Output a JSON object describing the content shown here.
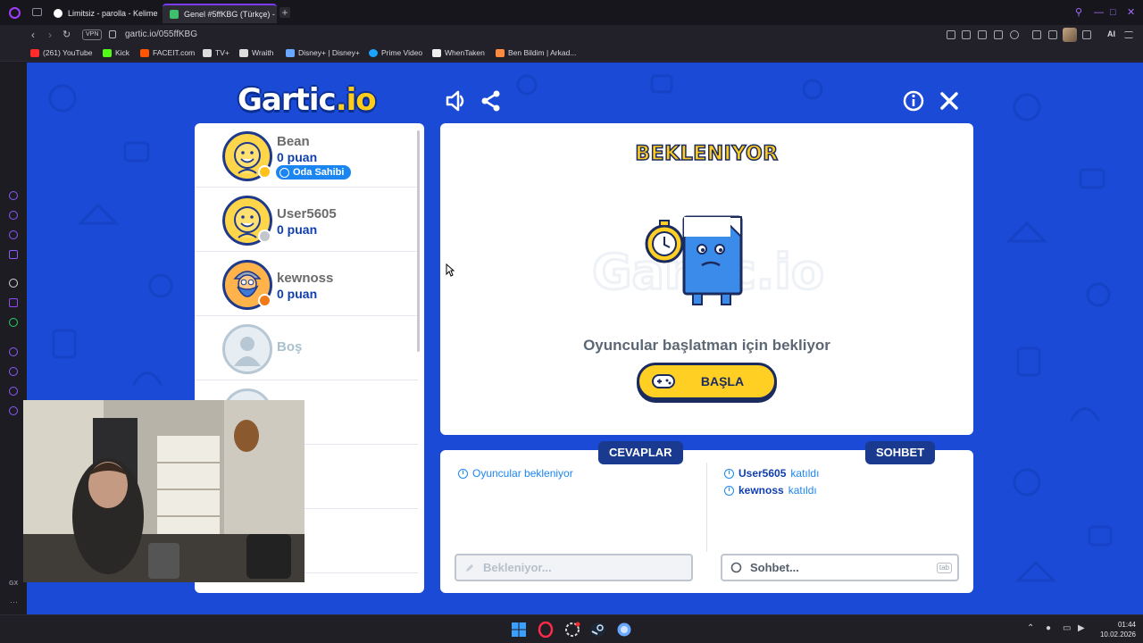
{
  "browser": {
    "tabs": [
      {
        "title": "Limitsiz - parolla - Kelime",
        "active": false
      },
      {
        "title": "Genel #5ffKBG (Türkçe) -",
        "active": true
      }
    ],
    "url": "gartic.io/055ffKBG",
    "vpn_label": "VPN",
    "ai_label": "AI",
    "bookmarks": [
      {
        "label": "(261) YouTube",
        "color": "#ff2a2a"
      },
      {
        "label": "Kick",
        "color": "#53fc18"
      },
      {
        "label": "FACEIT.com",
        "color": "#ff5500"
      },
      {
        "label": "TV+",
        "color": "#dddddd"
      },
      {
        "label": "Wraith",
        "color": "#dddddd"
      },
      {
        "label": "Disney+ | Disney+",
        "color": "#6aa8ff"
      },
      {
        "label": "Prime Video",
        "color": "#1aa3ff"
      },
      {
        "label": "WhenTaken",
        "color": "#eeeeee"
      },
      {
        "label": "Ben Bildim | Arkad...",
        "color": "#ff8a3d"
      }
    ]
  },
  "game": {
    "logo_main": "Gartic",
    "logo_suffix": ".io",
    "players": [
      {
        "name": "Bean",
        "score": "0 puan",
        "badge": "Oda Sahibi",
        "status_color": "#ffc21a",
        "avatar": "smiley"
      },
      {
        "name": "User5605",
        "score": "0 puan",
        "badge": "",
        "status_color": "#c3c7cc",
        "avatar": "smiley"
      },
      {
        "name": "kewnoss",
        "score": "0 puan",
        "badge": "",
        "status_color": "#f07a16",
        "avatar": "viking"
      },
      {
        "name": "Boş",
        "score": "",
        "badge": "",
        "status_color": "",
        "avatar": "empty"
      }
    ],
    "status_title": "BEKLENIYOR",
    "wait_message": "Oyuncular başlatman için bekliyor",
    "start_button": "BAŞLA",
    "answers_tab": "CEVAPLAR",
    "chat_tab": "SOHBET",
    "answers_messages": [
      {
        "text": "Oyuncular bekleniyor"
      }
    ],
    "chat_messages": [
      {
        "user": "User5605",
        "text": "katıldı"
      },
      {
        "user": "kewnoss",
        "text": "katıldı"
      }
    ],
    "answer_input_placeholder": "Bekleniyor...",
    "chat_input_placeholder": "Sohbet...",
    "chat_key_hint": "tab"
  },
  "taskbar": {
    "time": "01:44",
    "date": "10.02.2026"
  },
  "colors": {
    "background_blue": "#1a4ad6",
    "accent_yellow": "#ffcf24",
    "navy": "#1a3a8f",
    "link_blue": "#1b86f2"
  }
}
